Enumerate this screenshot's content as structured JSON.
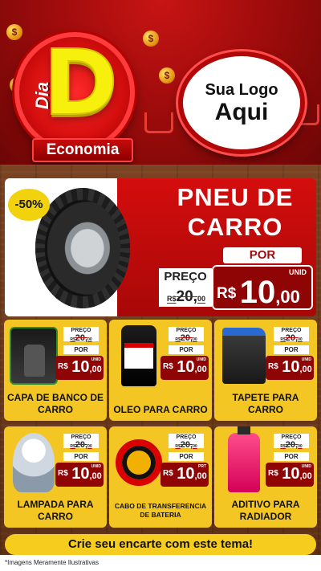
{
  "header": {
    "badge_dia": "Dia",
    "badge_letter": "D",
    "badge_ribbon": "Economia",
    "logo_line1": "Sua Logo",
    "logo_line2": "Aqui",
    "coin_symbol": "$"
  },
  "hero": {
    "discount": "-50%",
    "title_line1": "PNEU DE",
    "title_line2": "CARRO",
    "por": "POR",
    "preco_label": "PREÇO",
    "old_currency": "R$",
    "old_price": "20,",
    "old_cents": "00",
    "unid": "UNID",
    "currency": "R$",
    "price_int": "10",
    "price_cents": ",00"
  },
  "price_common": {
    "preco_label": "PREÇO",
    "old_currency": "R$",
    "old_price": "20,",
    "old_cents": "00",
    "por": "POR",
    "currency": "R$",
    "price_int": "10",
    "price_cents": ",00"
  },
  "products": [
    {
      "name": "CAPA DE BANCO DE CARRO",
      "unit": "UNID",
      "icon": "seat-cover-icon"
    },
    {
      "name": "OLEO PARA CARRO",
      "unit": "UNID",
      "icon": "oil-bottle-icon"
    },
    {
      "name": "TAPETE PARA CARRO",
      "unit": "UNID",
      "icon": "car-mat-icon"
    },
    {
      "name": "LAMPADA PARA CARRO",
      "unit": "UNID",
      "icon": "light-bulb-icon"
    },
    {
      "name": "CABO DE TRANSFERENCIA DE BATERIA",
      "unit": "PRT",
      "icon": "battery-cable-icon"
    },
    {
      "name": "ADITIVO PARA RADIADOR",
      "unit": "UNID",
      "icon": "radiator-additive-icon"
    }
  ],
  "cta": "Crie seu encarte com este tema!",
  "footer": "*Imagens Meramente Ilustrativas",
  "colors": {
    "red": "#c81414",
    "dark_red": "#8f0505",
    "yellow": "#f4c624",
    "wood": "#6b3a1c"
  }
}
